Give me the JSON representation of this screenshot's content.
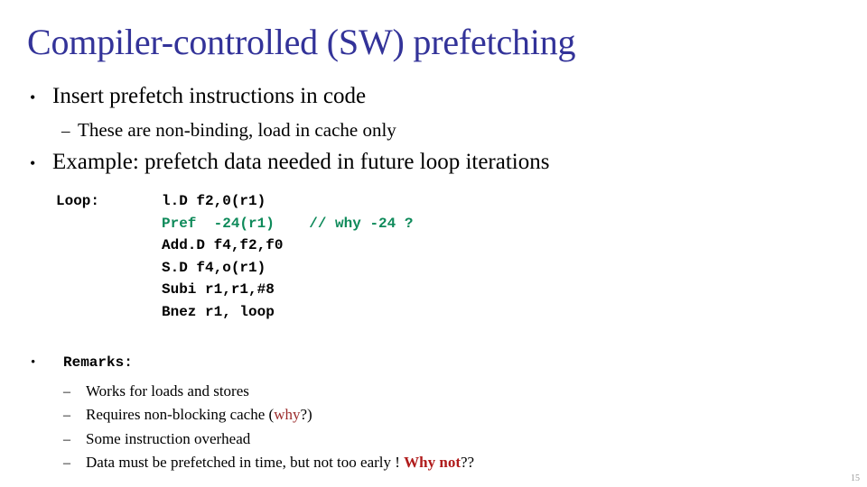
{
  "slide": {
    "title": "Compiler-controlled (SW) prefetching",
    "title_color": "#333399",
    "background": "#ffffff",
    "page_number": "15"
  },
  "bullets": [
    {
      "marker": "•",
      "text": "Insert prefetch instructions in code",
      "level": 1
    },
    {
      "marker": "–",
      "text": "These are non-binding, load in cache only",
      "level": 2
    },
    {
      "marker": "•",
      "text": "Example: prefetch data needed in future loop iterations",
      "level": 1
    }
  ],
  "code": {
    "accent_color": "#0E8A5A",
    "lines": [
      {
        "label": "Loop:",
        "instruction": "l.D f2,0(r1)",
        "comment": "",
        "highlight": false
      },
      {
        "label": "",
        "instruction": "Pref  -24(r1)",
        "comment": "// why -24 ?",
        "highlight": true
      },
      {
        "label": "",
        "instruction": "Add.D f4,f2,f0",
        "comment": "",
        "highlight": false
      },
      {
        "label": "",
        "instruction": "S.D f4,o(r1)",
        "comment": "",
        "highlight": false
      },
      {
        "label": "",
        "instruction": "Subi r1,r1,#8",
        "comment": "",
        "highlight": false
      },
      {
        "label": "",
        "instruction": "Bnez r1, loop",
        "comment": "",
        "highlight": false
      }
    ]
  },
  "remarks": {
    "marker": "•",
    "heading": "Remarks:",
    "items": [
      {
        "marker": "–",
        "pre": "Works for loads and stores",
        "emphasis": "",
        "emphasis_style": "",
        "post": ""
      },
      {
        "marker": "–",
        "pre": "Requires non-blocking cache (",
        "emphasis": "why",
        "emphasis_style": "red",
        "post": "?)"
      },
      {
        "marker": "–",
        "pre": "Some instruction overhead",
        "emphasis": "",
        "emphasis_style": "",
        "post": ""
      },
      {
        "marker": "–",
        "pre": "Data must be prefetched in time, but not too early ! ",
        "emphasis": "Why not",
        "emphasis_style": "red-bold",
        "post": "??"
      }
    ]
  },
  "colors": {
    "title": "#333399",
    "code_accent": "#0E8A5A",
    "emphasis_red": "#9B2B2B",
    "emphasis_red_bold": "#B01B1B",
    "page_number": "#9a9a9a"
  }
}
